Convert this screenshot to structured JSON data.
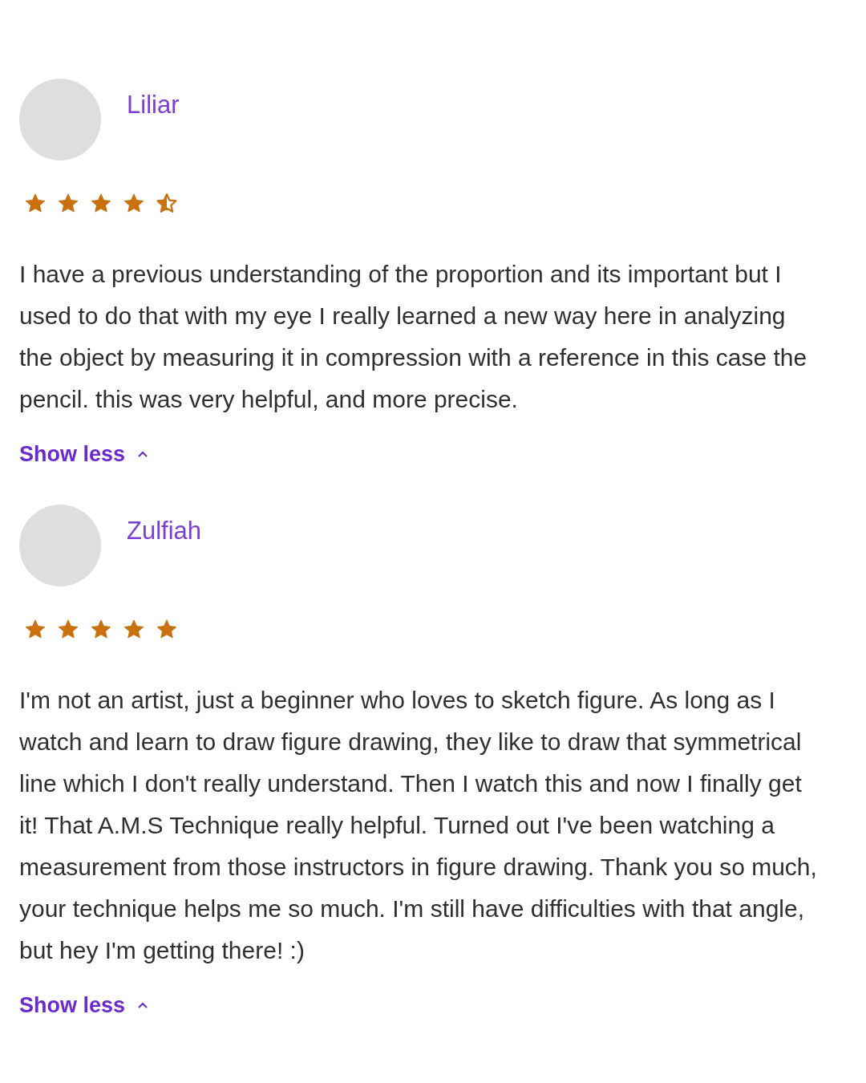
{
  "reviews": [
    {
      "name": "Liliar",
      "stars": 4.5,
      "text": "I have a previous understanding of the proportion and its important but I used to do that with my eye I really learned a new way here in analyzing the object by measuring it in compression with a reference in this case the pencil. this was very helpful, and more precise.",
      "toggle": "Show less",
      "expanded": true
    },
    {
      "name": "Zulfiah",
      "stars": 5,
      "text": "I'm not an artist, just a beginner who loves to sketch figure. As long as I watch and learn to draw figure drawing, they like to draw that symmetrical line which I don't really understand. Then I watch this and now I finally get it! That A.M.S Technique really helpful. Turned out I've been watching a measurement from those instructors in figure drawing. Thank you so much, your technique helps me so much. I'm still have difficulties with that angle, but hey I'm getting there! :)",
      "toggle": "Show less",
      "expanded": true
    }
  ]
}
